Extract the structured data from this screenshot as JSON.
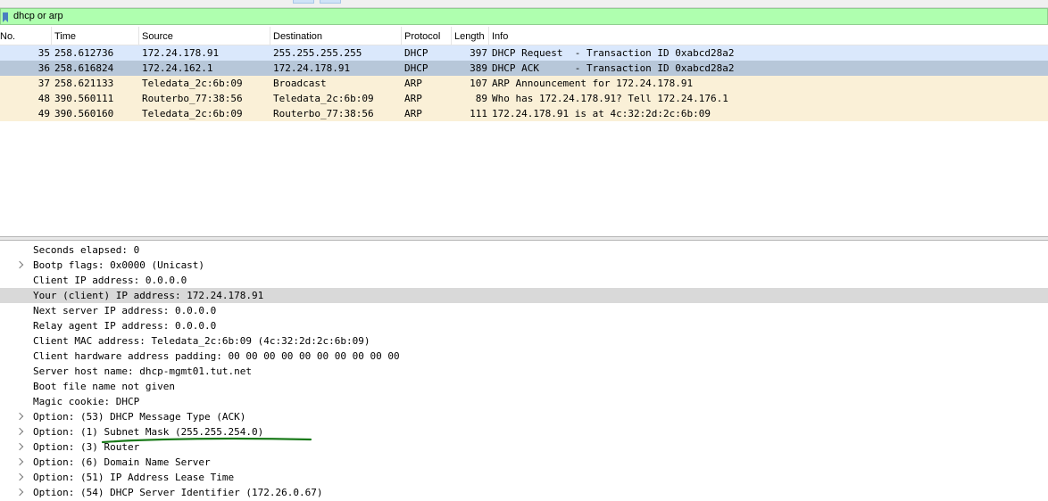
{
  "filter": {
    "value": "dhcp or arp",
    "bg": "#afffaf"
  },
  "packet_list": {
    "columns": [
      "No.",
      "Time",
      "Source",
      "Destination",
      "Protocol",
      "Length",
      "Info"
    ],
    "rows": [
      {
        "no": "35",
        "time": "258.612736",
        "source": "172.24.178.91",
        "destination": "255.255.255.255",
        "protocol": "DHCP",
        "length": "397",
        "info": "DHCP Request  - Transaction ID 0xabcd28a2"
      },
      {
        "no": "36",
        "time": "258.616824",
        "source": "172.24.162.1",
        "destination": "172.24.178.91",
        "protocol": "DHCP",
        "length": "389",
        "info": "DHCP ACK      - Transaction ID 0xabcd28a2"
      },
      {
        "no": "37",
        "time": "258.621133",
        "source": "Teledata_2c:6b:09",
        "destination": "Broadcast",
        "protocol": "ARP",
        "length": "107",
        "info": "ARP Announcement for 172.24.178.91"
      },
      {
        "no": "48",
        "time": "390.560111",
        "source": "Routerbo_77:38:56",
        "destination": "Teledata_2c:6b:09",
        "protocol": "ARP",
        "length": "89",
        "info": "Who has 172.24.178.91? Tell 172.24.176.1"
      },
      {
        "no": "49",
        "time": "390.560160",
        "source": "Teledata_2c:6b:09",
        "destination": "Routerbo_77:38:56",
        "protocol": "ARP",
        "length": "111",
        "info": "172.24.178.91 is at 4c:32:2d:2c:6b:09"
      }
    ]
  },
  "details": {
    "lines": [
      {
        "text": "Seconds elapsed: 0",
        "expandable": false
      },
      {
        "text": "Bootp flags: 0x0000 (Unicast)",
        "expandable": true
      },
      {
        "text": "Client IP address: 0.0.0.0",
        "expandable": false
      },
      {
        "text": "Your (client) IP address: 172.24.178.91",
        "expandable": false
      },
      {
        "text": "Next server IP address: 0.0.0.0",
        "expandable": false
      },
      {
        "text": "Relay agent IP address: 0.0.0.0",
        "expandable": false
      },
      {
        "text": "Client MAC address: Teledata_2c:6b:09 (4c:32:2d:2c:6b:09)",
        "expandable": false
      },
      {
        "text": "Client hardware address padding: 00 00 00 00 00 00 00 00 00 00",
        "expandable": false
      },
      {
        "text": "Server host name: dhcp-mgmt01.tut.net",
        "expandable": false
      },
      {
        "text": "Boot file name not given",
        "expandable": false
      },
      {
        "text": "Magic cookie: DHCP",
        "expandable": false
      },
      {
        "text": "Option: (53) DHCP Message Type (ACK)",
        "expandable": true
      },
      {
        "text": "Option: (1) Subnet Mask (255.255.254.0)",
        "expandable": true
      },
      {
        "text": "Option: (3) Router",
        "expandable": true
      },
      {
        "text": "Option: (6) Domain Name Server",
        "expandable": true
      },
      {
        "text": "Option: (51) IP Address Lease Time",
        "expandable": true
      },
      {
        "text": "Option: (54) DHCP Server Identifier (172.26.0.67)",
        "expandable": true
      }
    ],
    "highlighted_index": 3
  },
  "colors": {
    "dhcp_row": "#dae8fc",
    "selected_row": "#b7c7d9",
    "arp_row": "#faf0d7",
    "annotation": "#1a7a1a"
  }
}
